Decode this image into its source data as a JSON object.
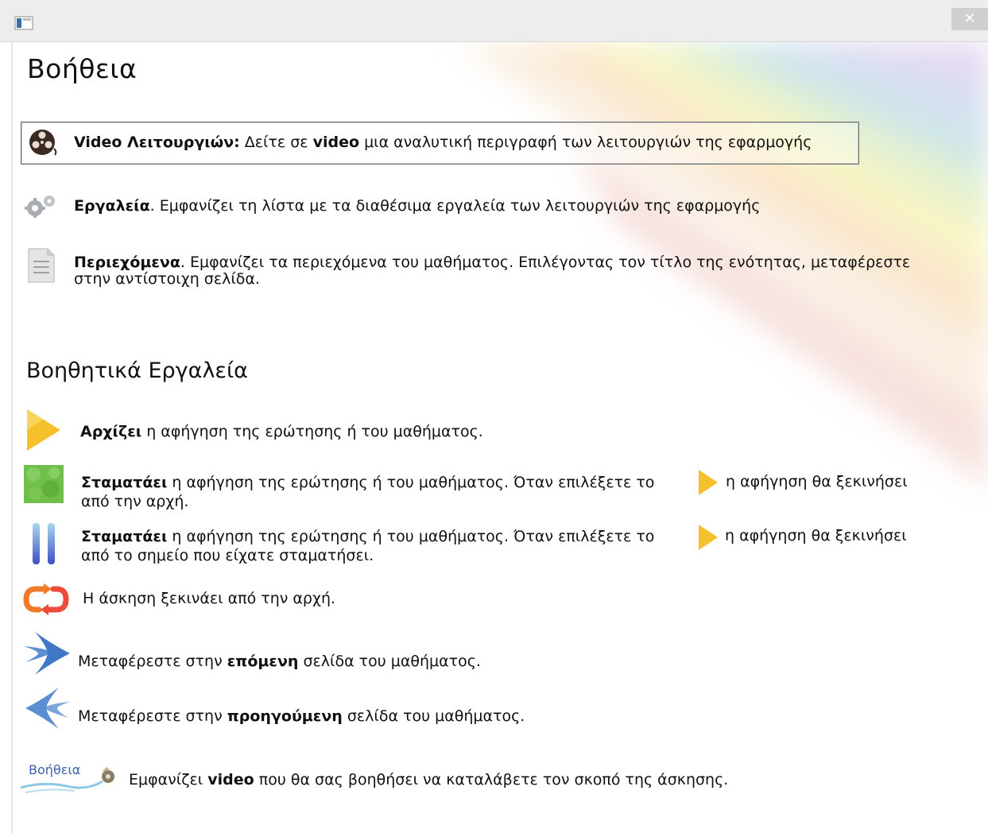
{
  "window": {
    "close_glyph": "✕"
  },
  "page_title": "Βοήθεια",
  "video_button": {
    "bold_label": "Video Λειτουργιών:",
    "text_a": " Δείτε σε ",
    "bold_video": "video",
    "text_b": " μια αναλυτική περιγραφή των λειτουργιών της εφαρμογής"
  },
  "tools": {
    "bold": "Εργαλεία",
    "text": ". Εμφανίζει τη λίστα με τα διαθέσιμα εργαλεία των λειτουργιών της εφαρμογής"
  },
  "contents": {
    "bold": "Περιεχόμενα",
    "text_line1": ". Εμφανίζει τα περιεχόμενα του μαθήματος. Επιλέγοντας τον τίτλο της ενότητας, μεταφέρεστε",
    "text_line2": "στην αντίστοιχη σελίδα."
  },
  "section_title": "Βοηθητικά Εργαλεία",
  "play": {
    "bold": "Αρχίζει",
    "text": " η αφήγηση της ερώτησης ή του μαθήματος."
  },
  "stop": {
    "bold": "Σταματάει",
    "text_a": " η αφήγηση της ερώτησης ή του μαθήματος. Όταν επιλέξετε το",
    "text_b": "η αφήγηση θα ξεκινήσει",
    "text_line2": "από την αρχή."
  },
  "pause": {
    "bold": "Σταματάει",
    "text_a": " η αφήγηση της ερώτησης ή του μαθήματος. Όταν επιλέξετε το",
    "text_b": "η αφήγηση θα ξεκινήσει",
    "text_line2": "από το σημείο που είχατε σταματήσει."
  },
  "restart": {
    "text": "Η άσκηση ξεκινάει από την αρχή."
  },
  "next": {
    "text_a": "Μεταφέρεστε στην ",
    "bold": "επόμενη",
    "text_b": " σελίδα του μαθήματος."
  },
  "prev": {
    "text_a": "Μεταφέρεστε στην ",
    "bold": "προηγούμενη",
    "text_b": " σελίδα του μαθήματος."
  },
  "help": {
    "icon_label": "Βοήθεια",
    "text_a": "Εμφανίζει ",
    "bold": "video",
    "text_b": " που θα σας βοηθήσει να καταλάβετε τον σκοπό της άσκησης."
  },
  "colors": {
    "play_yellow": "#f7c531",
    "stop_green": "#6fbf4a",
    "pause_blue": "#4a62c9",
    "restart_orange": "#f07a2a",
    "arrow_blue": "#3f79c6"
  },
  "icons": [
    "window-icon",
    "close-icon",
    "film-reel-icon",
    "gears-icon",
    "document-icon",
    "play-icon",
    "stop-icon",
    "pause-icon",
    "restart-icon",
    "next-arrow-icon",
    "prev-arrow-icon",
    "help-video-icon"
  ]
}
